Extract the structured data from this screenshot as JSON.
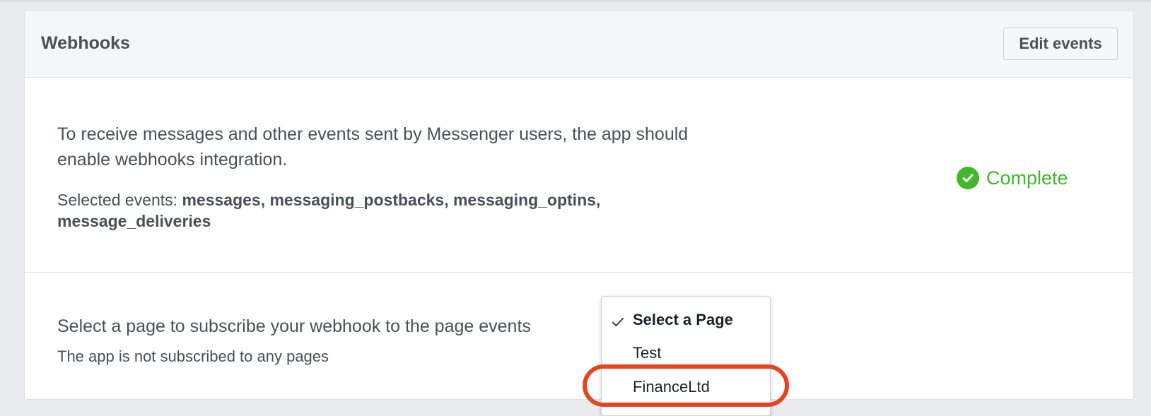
{
  "header": {
    "title": "Webhooks",
    "edit_button_label": "Edit events"
  },
  "webhooks": {
    "description": "To receive messages and other events sent by Messenger users, the app should enable webhooks integration.",
    "selected_events_label": "Selected events:",
    "selected_events_value": "messages, messaging_postbacks, messaging_optins, message_deliveries",
    "status_icon": "check-circle-icon",
    "status_text": "Complete",
    "status_color": "#42b72a"
  },
  "subscription": {
    "prompt": "Select a page to subscribe your webhook to the page events",
    "status_text": "The app is not subscribed to any pages"
  },
  "page_dropdown": {
    "selected_value": "Select a Page",
    "options": [
      {
        "label": "Select a Page",
        "selected": true
      },
      {
        "label": "Test",
        "selected": false
      },
      {
        "label": "FinanceLtd",
        "selected": false
      }
    ]
  },
  "annotation": {
    "highlight_color": "#e8431f",
    "highlighted_option": "FinanceLtd"
  }
}
